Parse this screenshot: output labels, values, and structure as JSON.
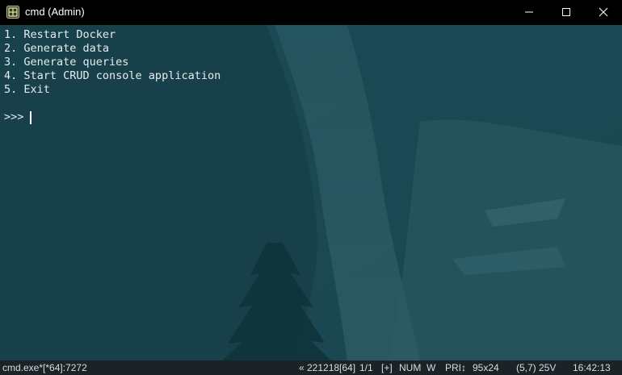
{
  "window": {
    "title": "cmd (Admin)",
    "icons": {
      "app": "console-app-icon",
      "minimize": "minimize-icon",
      "maximize": "maximize-icon",
      "close": "close-icon"
    }
  },
  "console": {
    "lines": [
      "1. Restart Docker",
      "2. Generate data",
      "3. Generate queries",
      "4. Start CRUD console application",
      "5. Exit"
    ],
    "prompt": ">>> "
  },
  "statusbar": {
    "process": "cmd.exe*[*64]:7272",
    "console_info": "« 221218[64]",
    "tab_index": "1/1",
    "plus": "[+]",
    "num": "NUM",
    "w": "W",
    "pri": "PRI↕",
    "size": "95x24",
    "cursor_pos": "(5,7) 25V",
    "time": "16:42:13"
  },
  "colors": {
    "titlebar": "#000000",
    "console_bg": "#1b4b55",
    "console_text": "#e6ecee",
    "statusbar_bg": "#1b2326"
  }
}
